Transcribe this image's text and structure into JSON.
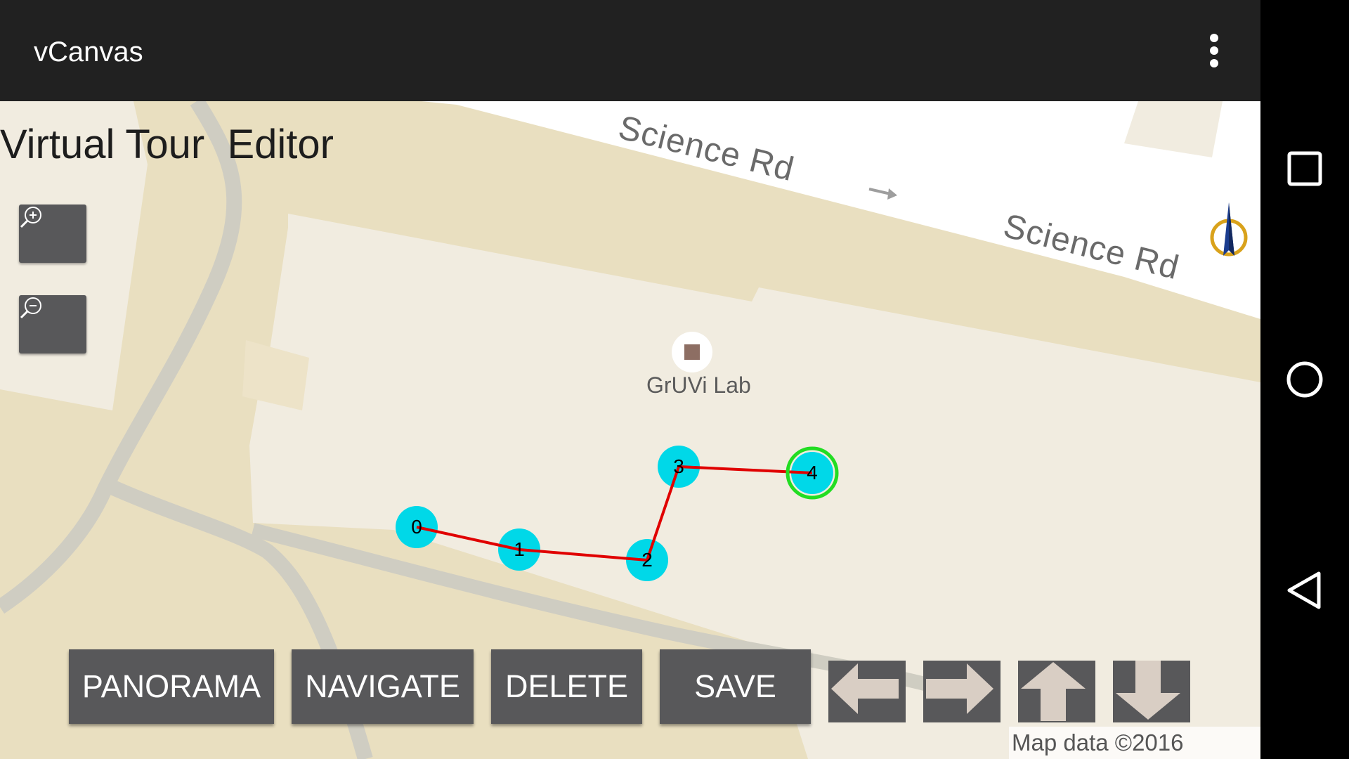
{
  "app_bar": {
    "title": "vCanvas",
    "overflow_icon": "more-vert-icon"
  },
  "editor": {
    "title": "Virtual Tour  Editor",
    "zoom_in_icon": "zoom-in-icon",
    "zoom_out_icon": "zoom-out-icon",
    "compass_icon": "compass-icon"
  },
  "map": {
    "road_labels": [
      "Science Rd",
      "Science Rd"
    ],
    "poi_name": "GrUVi Lab",
    "attribution": "Map data ©2016"
  },
  "tour_path": {
    "node_labels": [
      "0",
      "1",
      "2",
      "3",
      "4"
    ],
    "selected_node": "4",
    "node_color": "#00d8e8",
    "path_color": "#e00000",
    "selected_ring_color": "#22dd22"
  },
  "toolbar": {
    "panorama_label": "PANORAMA",
    "navigate_label": "NAVIGATE",
    "delete_label": "DELETE",
    "save_label": "SAVE",
    "arrow_icons": [
      "arrow-left-icon",
      "arrow-right-icon",
      "arrow-up-icon",
      "arrow-down-icon"
    ]
  },
  "system_nav": {
    "icons": [
      "recents-icon",
      "home-icon",
      "back-icon"
    ]
  }
}
